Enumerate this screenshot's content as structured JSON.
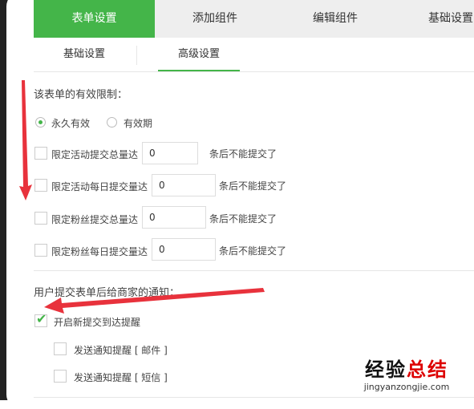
{
  "tabs": [
    {
      "label": "表单设置",
      "active": true
    },
    {
      "label": "添加组件",
      "active": false
    },
    {
      "label": "编辑组件",
      "active": false
    },
    {
      "label": "基础设置",
      "active": false
    }
  ],
  "subtabs": [
    {
      "label": "基础设置",
      "active": false
    },
    {
      "label": "高级设置",
      "active": true
    }
  ],
  "validity": {
    "heading": "该表单的有效限制：",
    "options": [
      {
        "label": "永久有效",
        "checked": true
      },
      {
        "label": "有效期",
        "checked": false
      }
    ]
  },
  "limits": [
    {
      "label": "限定活动提交总量达",
      "value": "0",
      "suffix": "条后不能提交了",
      "checked": false
    },
    {
      "label": "限定活动每日提交量达",
      "value": "0",
      "suffix": "条后不能提交了",
      "checked": false
    },
    {
      "label": "限定粉丝提交总量达",
      "value": "0",
      "suffix": "条后不能提交了",
      "checked": false
    },
    {
      "label": "限定粉丝每日提交量达",
      "value": "0",
      "suffix": "条后不能提交了",
      "checked": false
    }
  ],
  "notify": {
    "heading": "用户提交表单后给商家的通知：",
    "enable": {
      "label": "开启新提交到达提醒",
      "checked": true
    },
    "options": [
      {
        "label": "发送通知提醒 [ 邮件 ]",
        "checked": false
      },
      {
        "label": "发送通知提醒 [ 短信 ]",
        "checked": false
      }
    ]
  },
  "watermark": {
    "part1": "经验",
    "part2": "总结",
    "url": "jingyanzongjie.com"
  },
  "colors": {
    "accent": "#44b549",
    "arrow": "#e8323c",
    "tab_bg": "#eeeeee"
  }
}
